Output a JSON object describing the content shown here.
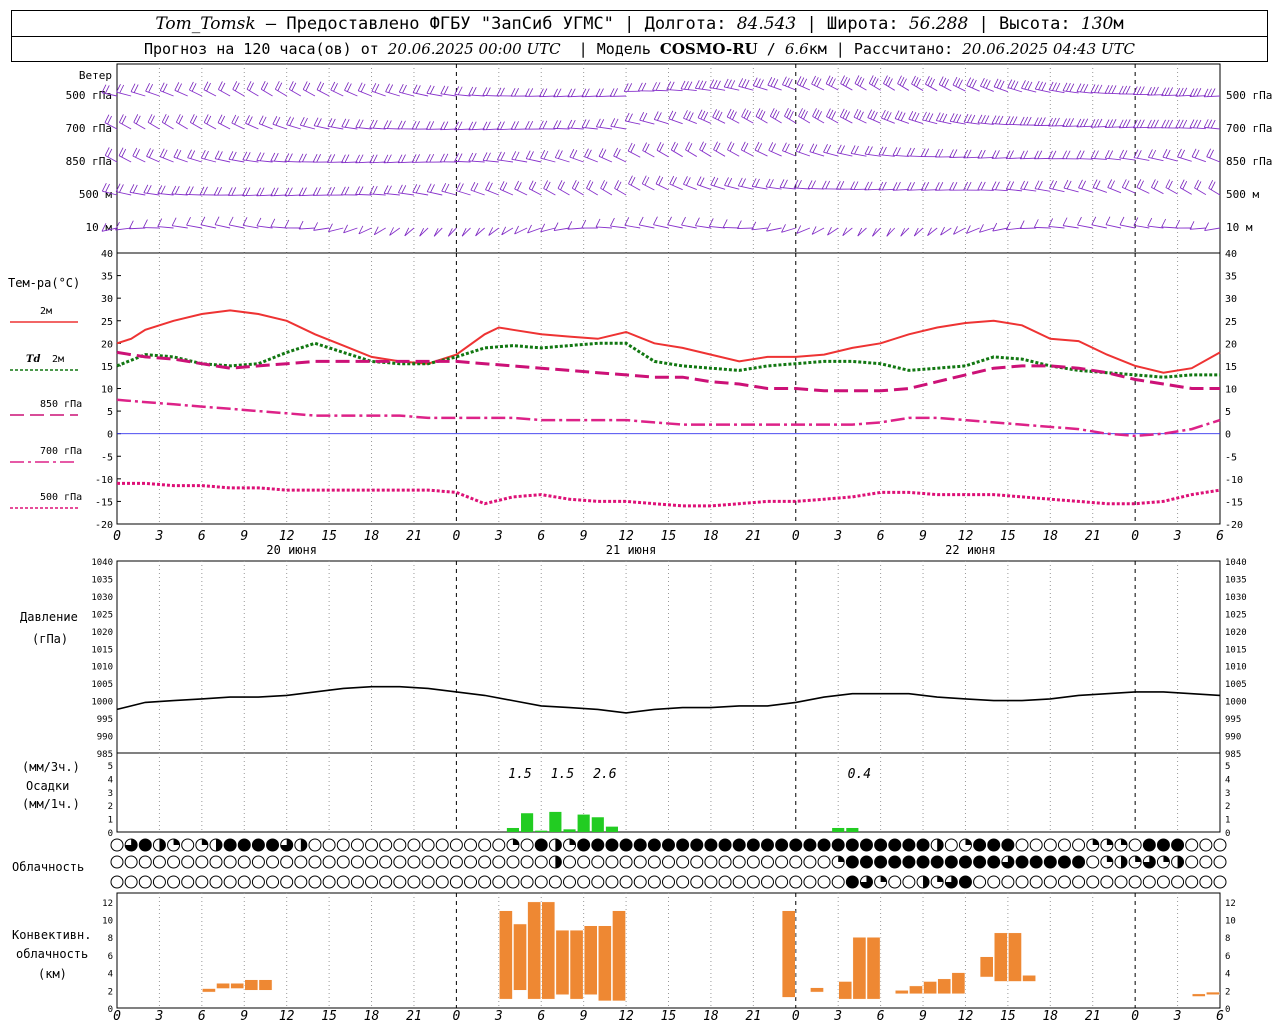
{
  "header": {
    "line1": {
      "station": "Tom_Tomsk",
      "provided": " – Предоставлено ФГБУ \"ЗапСиб УГМС\" | Долгота: ",
      "lon": "84.543",
      "lat_label": " | Широта: ",
      "lat": "56.288",
      "alt_label": " | Высота: ",
      "alt": "130",
      "alt_unit": "м"
    },
    "line2": {
      "forecast_pre": "Прогноз на 120 часа(ов) от ",
      "from": "20.06.2025 00:00 UTC",
      "model_label": "  | Модель ",
      "model": "COSMO-RU",
      "model_sep": " / ",
      "res": "6.6",
      "res_unit": "км",
      "calc_label": " | Рассчитано: ",
      "calc": "20.06.2025 04:43 UTC"
    }
  },
  "chart_data": {
    "type": "meteogram",
    "x": {
      "unit": "hours from 20.06.2025 00:00 UTC",
      "range": [
        0,
        78
      ],
      "tick_labels": [
        "0",
        "3",
        "6",
        "9",
        "12",
        "15",
        "18",
        "21",
        "0",
        "3",
        "6",
        "9",
        "12",
        "15",
        "18",
        "21",
        "0",
        "3",
        "6",
        "9",
        "12",
        "15",
        "18",
        "21",
        "0",
        "3",
        "6"
      ],
      "day_labels": [
        {
          "hour": 12,
          "label": "20 июня"
        },
        {
          "hour": 36,
          "label": "21 июня"
        },
        {
          "hour": 60,
          "label": "22 июня"
        }
      ]
    },
    "wind": {
      "title": "Ветер",
      "levels": [
        "500 гПа",
        "700 гПа",
        "850 гПа",
        "500 м",
        "10 м"
      ]
    },
    "temperature": {
      "ylabel": "Тем-ра(°C)",
      "ylim": [
        -20,
        40
      ],
      "ticks": [
        -20,
        -15,
        -10,
        -5,
        0,
        5,
        10,
        15,
        20,
        25,
        30,
        35,
        40
      ],
      "series": [
        {
          "name": "2м",
          "color": "#ee3333",
          "style": "solid",
          "x": [
            0,
            1,
            2,
            4,
            6,
            8,
            10,
            12,
            14,
            16,
            18,
            20,
            22,
            24,
            26,
            27,
            28,
            30,
            32,
            34,
            36,
            38,
            40,
            42,
            44,
            46,
            48,
            50,
            52,
            54,
            56,
            58,
            60,
            62,
            64,
            66,
            68,
            70,
            72,
            74,
            76,
            78
          ],
          "values": [
            20,
            21,
            23,
            25,
            26.5,
            27.3,
            26.5,
            25,
            22,
            19.5,
            17,
            16,
            15.5,
            17.5,
            22,
            23.5,
            23,
            22,
            21.5,
            21,
            22.5,
            20,
            19,
            17.5,
            16,
            17,
            17,
            17.5,
            19,
            20,
            22,
            23.5,
            24.5,
            25,
            24,
            21,
            20.5,
            17.5,
            15,
            13.5,
            14.5,
            18
          ]
        },
        {
          "name_prefix": "Td",
          "name": "2м",
          "color": "#117711",
          "style": "dotted",
          "x": [
            0,
            2,
            4,
            6,
            8,
            10,
            12,
            14,
            16,
            18,
            20,
            22,
            24,
            26,
            28,
            30,
            32,
            34,
            36,
            38,
            40,
            42,
            44,
            46,
            48,
            50,
            52,
            54,
            56,
            58,
            60,
            62,
            64,
            66,
            68,
            70,
            72,
            74,
            76,
            78
          ],
          "values": [
            15,
            17.5,
            17,
            15.5,
            15,
            15.5,
            18,
            20,
            18,
            16,
            15.5,
            15.5,
            17,
            19,
            19.5,
            19,
            19.5,
            20,
            20,
            16,
            15,
            14.5,
            14,
            15,
            15.5,
            16,
            16,
            15.5,
            14,
            14.5,
            15,
            17,
            16.5,
            15,
            14,
            13.5,
            13,
            12.5,
            13,
            13
          ]
        },
        {
          "name": "850 гПа",
          "color": "#cc1177",
          "style": "dashed",
          "x": [
            0,
            2,
            4,
            6,
            8,
            10,
            12,
            14,
            16,
            18,
            20,
            22,
            24,
            26,
            28,
            30,
            32,
            34,
            36,
            38,
            40,
            42,
            44,
            46,
            48,
            50,
            52,
            54,
            56,
            58,
            60,
            62,
            64,
            66,
            68,
            70,
            72,
            74,
            76,
            78
          ],
          "values": [
            18,
            17,
            16.5,
            15.5,
            14.5,
            15,
            15.5,
            16,
            16,
            16,
            16,
            16,
            16,
            15.5,
            15,
            14.5,
            14,
            13.5,
            13,
            12.5,
            12.5,
            11.5,
            11,
            10,
            10,
            9.5,
            9.5,
            9.5,
            10,
            11.5,
            13,
            14.5,
            15,
            15,
            14.5,
            13.5,
            12,
            11,
            10,
            10
          ]
        },
        {
          "name": "700 гПа",
          "color": "#dd2288",
          "style": "dashdot",
          "x": [
            0,
            2,
            4,
            6,
            8,
            10,
            12,
            14,
            16,
            18,
            20,
            22,
            24,
            26,
            28,
            30,
            32,
            34,
            36,
            38,
            40,
            42,
            44,
            46,
            48,
            50,
            52,
            54,
            56,
            58,
            60,
            62,
            64,
            66,
            68,
            70,
            72,
            74,
            76,
            78
          ],
          "values": [
            7.5,
            7,
            6.5,
            6,
            5.5,
            5,
            4.5,
            4,
            4,
            4,
            4,
            3.5,
            3.5,
            3.5,
            3.5,
            3,
            3,
            3,
            3,
            2.5,
            2,
            2,
            2,
            2,
            2,
            2,
            2,
            2.5,
            3.5,
            3.5,
            3,
            2.5,
            2,
            1.5,
            1,
            0,
            -0.5,
            0,
            1,
            3
          ]
        },
        {
          "name": "500 гПа",
          "color": "#dd1177",
          "style": "dotted",
          "x": [
            0,
            2,
            4,
            6,
            8,
            10,
            12,
            14,
            16,
            18,
            20,
            22,
            24,
            26,
            28,
            30,
            32,
            34,
            36,
            38,
            40,
            42,
            44,
            46,
            48,
            50,
            52,
            54,
            56,
            58,
            60,
            62,
            64,
            66,
            68,
            70,
            72,
            74,
            76,
            78
          ],
          "values": [
            -11,
            -11,
            -11.5,
            -11.5,
            -12,
            -12,
            -12.5,
            -12.5,
            -12.5,
            -12.5,
            -12.5,
            -12.5,
            -13,
            -15.5,
            -14,
            -13.5,
            -14.5,
            -15,
            -15,
            -15.5,
            -16,
            -16,
            -15.5,
            -15,
            -15,
            -14.5,
            -14,
            -13,
            -13,
            -13.5,
            -13.5,
            -13.5,
            -14,
            -14.5,
            -15,
            -15.5,
            -15.5,
            -15,
            -13.5,
            -12.5
          ]
        }
      ]
    },
    "pressure": {
      "ylabel_1": "Давление",
      "ylabel_2": "(гПа)",
      "ylim": [
        985,
        1040
      ],
      "ticks": [
        985,
        990,
        995,
        1000,
        1005,
        1010,
        1015,
        1020,
        1025,
        1030,
        1035,
        1040
      ],
      "x": [
        0,
        2,
        4,
        6,
        8,
        10,
        12,
        14,
        16,
        18,
        20,
        22,
        24,
        26,
        28,
        30,
        32,
        34,
        36,
        38,
        40,
        42,
        44,
        46,
        48,
        50,
        52,
        54,
        56,
        58,
        60,
        62,
        64,
        66,
        68,
        70,
        72,
        74,
        76,
        78
      ],
      "values": [
        997.5,
        999.5,
        1000,
        1000.5,
        1001,
        1001,
        1001.5,
        1002.5,
        1003.5,
        1004,
        1004,
        1003.5,
        1002.5,
        1001.5,
        1000,
        998.5,
        998,
        997.5,
        996.5,
        997.5,
        998,
        998,
        998.5,
        998.5,
        999.5,
        1001,
        1002,
        1002,
        1002,
        1001,
        1000.5,
        1000,
        1000,
        1000.5,
        1001.5,
        1002,
        1002.5,
        1002.5,
        1002,
        1001.5
      ]
    },
    "precipitation": {
      "ylabel_1": "(мм/3ч.)",
      "ylabel_2": "Осадки",
      "ylabel_3": "(мм/1ч.)",
      "ylim": [
        0,
        5
      ],
      "ticks": [
        0,
        1,
        2,
        3,
        4,
        5
      ],
      "color": "#22cc22",
      "bars": [
        {
          "hour": 28,
          "value": 0.3
        },
        {
          "hour": 29,
          "value": 1.4
        },
        {
          "hour": 30,
          "value": 0.1
        },
        {
          "hour": 31,
          "value": 1.5
        },
        {
          "hour": 32,
          "value": 0.2
        },
        {
          "hour": 33,
          "value": 1.3
        },
        {
          "hour": 34,
          "value": 1.1
        },
        {
          "hour": 35,
          "value": 0.4
        },
        {
          "hour": 51,
          "value": 0.3
        },
        {
          "hour": 52,
          "value": 0.3
        }
      ],
      "totals": [
        {
          "hour": 28.5,
          "label": "1.5"
        },
        {
          "hour": 31.5,
          "label": "1.5"
        },
        {
          "hour": 34.5,
          "label": "2.6"
        },
        {
          "hour": 52.5,
          "label": "0.4"
        }
      ]
    },
    "cloudiness": {
      "ylabel": "Облачность",
      "rows": [
        "03421012444432000000000000001042144444444444444444444444442014440000011104440001040000444440000000000000002400000000000000000000000044004441212",
        "00000000000000000000000000000002000000000000000000014444444444434444401213120000000000000001442111110000000000000442001444110000000020000000000000001400000000000000001",
        "00000000000000000000000000000000000000000000000000004310021340000000000000000000000000004444401410000000000000000000000000000000000000000000000000000000000000000000000"
      ]
    },
    "convective": {
      "ylabel_1": "Конвективн.",
      "ylabel_2": "облачность",
      "ylabel_3": "(км)",
      "ylim": [
        0,
        13
      ],
      "ticks": [
        0,
        2,
        4,
        6,
        8,
        10,
        12
      ],
      "color": "#ee8833",
      "bars": [
        {
          "hour": 6.5,
          "base": 1.8,
          "top": 2.2
        },
        {
          "hour": 7.5,
          "base": 2.2,
          "top": 2.8
        },
        {
          "hour": 8.5,
          "base": 2.2,
          "top": 2.8
        },
        {
          "hour": 9.5,
          "base": 2.0,
          "top": 3.2
        },
        {
          "hour": 10.5,
          "base": 2.0,
          "top": 3.2
        },
        {
          "hour": 27.5,
          "base": 1.0,
          "top": 11
        },
        {
          "hour": 28.5,
          "base": 2.0,
          "top": 9.5
        },
        {
          "hour": 29.5,
          "base": 1.0,
          "top": 12
        },
        {
          "hour": 30.5,
          "base": 1.0,
          "top": 12
        },
        {
          "hour": 31.5,
          "base": 1.5,
          "top": 8.8
        },
        {
          "hour": 32.5,
          "base": 1.0,
          "top": 8.8
        },
        {
          "hour": 33.5,
          "base": 1.5,
          "top": 9.3
        },
        {
          "hour": 34.5,
          "base": 0.8,
          "top": 9.3
        },
        {
          "hour": 35.5,
          "base": 0.8,
          "top": 11
        },
        {
          "hour": 47.5,
          "base": 1.2,
          "top": 11
        },
        {
          "hour": 49.5,
          "base": 1.8,
          "top": 2.3
        },
        {
          "hour": 51.5,
          "base": 1.0,
          "top": 3.0
        },
        {
          "hour": 52.5,
          "base": 1.0,
          "top": 8.0
        },
        {
          "hour": 53.5,
          "base": 1.0,
          "top": 8.0
        },
        {
          "hour": 55.5,
          "base": 1.6,
          "top": 2.0
        },
        {
          "hour": 56.5,
          "base": 1.6,
          "top": 2.5
        },
        {
          "hour": 57.5,
          "base": 1.6,
          "top": 3.0
        },
        {
          "hour": 58.5,
          "base": 1.6,
          "top": 3.3
        },
        {
          "hour": 59.5,
          "base": 1.6,
          "top": 4.0
        },
        {
          "hour": 61.5,
          "base": 3.5,
          "top": 5.8
        },
        {
          "hour": 62.5,
          "base": 3.0,
          "top": 8.5
        },
        {
          "hour": 63.5,
          "base": 3.0,
          "top": 8.5
        },
        {
          "hour": 64.5,
          "base": 3.0,
          "top": 3.7
        },
        {
          "hour": 76.5,
          "base": 1.3,
          "top": 1.6
        },
        {
          "hour": 77.5,
          "base": 1.5,
          "top": 1.8
        }
      ]
    }
  }
}
